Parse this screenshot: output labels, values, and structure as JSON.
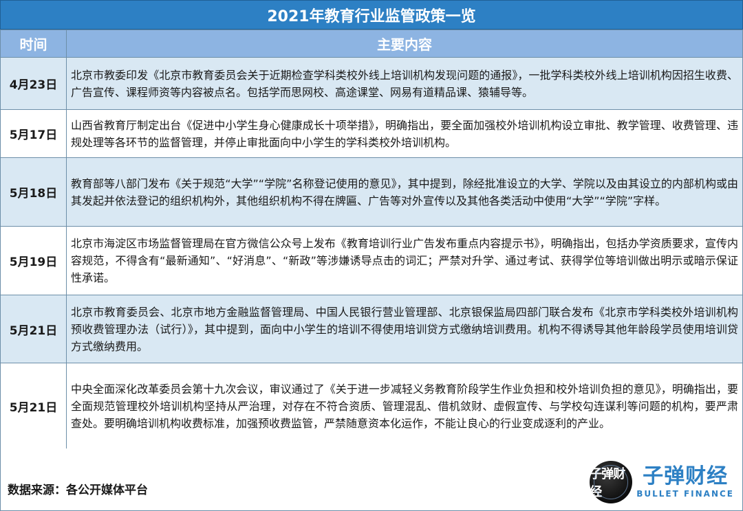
{
  "title": "2021年教育行业监管政策一览",
  "columns": {
    "time": "时间",
    "content": "主要内容"
  },
  "rows": [
    {
      "date": "4月23日",
      "text": "北京市教委印发《北京市教育委员会关于近期检查学科类校外线上培训机构发现问题的通报》，一批学科类校外线上培训机构因招生收费、广告宣传、课程师资等内容被点名。包括学而思网校、高途课堂、网易有道精品课、猿辅导等。"
    },
    {
      "date": "5月17日",
      "text": "山西省教育厅制定出台《促进中小学生身心健康成长十项举措》，明确指出，要全面加强校外培训机构设立审批、教学管理、收费管理、违规处理等各环节的监督管理，并停止审批面向中小学生的学科类校外培训机构。"
    },
    {
      "date": "5月18日",
      "text": "教育部等八部门发布《关于规范“大学”“学院”名称登记使用的意见》，其中提到，除经批准设立的大学、学院以及由其设立的内部机构或由其发起并依法登记的组织机构外，其他组织机构不得在牌匾、广告等对外宣传以及其他各类活动中使用“大学”“学院”字样。"
    },
    {
      "date": "5月19日",
      "text": "北京市海淀区市场监督管理局在官方微信公众号上发布《教育培训行业广告发布重点内容提示书》，明确指出，包括办学资质要求，宣传内容规范，不得含有“最新通知”、“好消息”、“新政”等涉嫌诱导点击的词汇；严禁对升学、通过考试、获得学位等培训做出明示或暗示保证性承诺。"
    },
    {
      "date": "5月21日",
      "text": "北京市教育委员会、北京市地方金融监督管理局、中国人民银行营业管理部、北京银保监局四部门联合发布《北京市学科类校外培训机构预收费管理办法（试行）》，其中提到，面向中小学生的培训不得使用培训贷方式缴纳培训费用。机构不得诱导其他年龄段学员使用培训贷方式缴纳费用。"
    },
    {
      "date": "5月21日",
      "text": "中央全面深化改革委员会第十九次会议，审议通过了《关于进一步减轻义务教育阶段学生作业负担和校外培训负担的意见》，明确指出，要全面规范管理校外培训机构坚持从严治理，对存在不符合资质、管理混乱、借机敛财、虚假宣传、与学校勾连谋利等问题的机构，要严肃查处。要明确培训机构收费标准，加强预收费监管，严禁随意资本化运作，不能让良心的行业变成逐利的产业。"
    }
  ],
  "footer": {
    "source": "数据来源：各公开媒体平台",
    "logo_cn": "子弹财经",
    "logo_en": "BULLET FINANCE",
    "logo_badge": "子弹财经",
    "logo_icon": "bullet-finance-logo-icon"
  },
  "colors": {
    "title_bg": "#2d80c4",
    "header_bg": "#8db4e2",
    "shade_bg": "#d9e8f3",
    "brand": "#2d80c4"
  }
}
